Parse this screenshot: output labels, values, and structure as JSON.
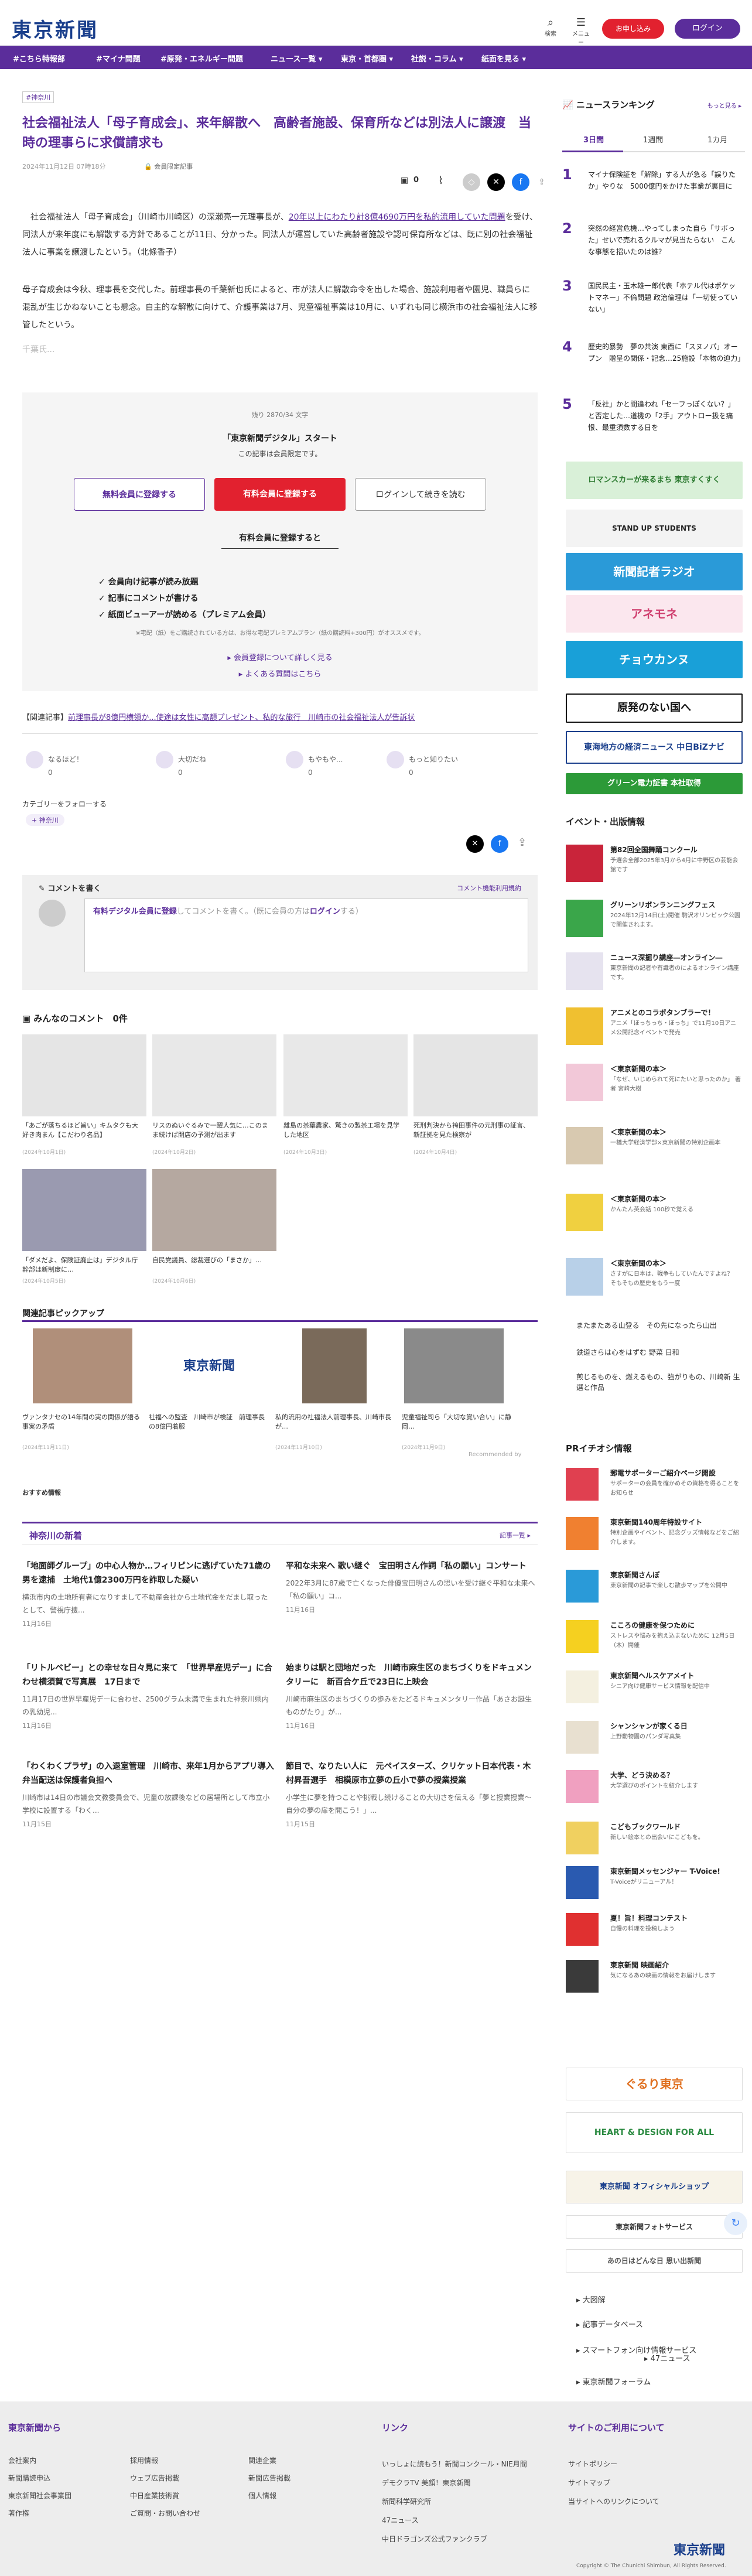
{
  "header": {
    "logo": "東京新聞",
    "search_label": "検索",
    "menu_label": "メニュー",
    "register_button": "お申し込み",
    "login_button": "ログイン"
  },
  "nav": [
    "#こちら特報部",
    "#マイナ問題",
    "#原発・エネルギー問題",
    "ニュース一覧 ▾",
    "東京・首都圏 ▾",
    "社説・コラム ▾",
    "紙面を見る ▾"
  ],
  "article": {
    "category_tag": "#神奈川",
    "title": "社会福祉法人「母子育成会」、来年解散へ　高齢者施設、保育所などは別法人に譲渡　当時の理事らに求償請求も",
    "date": "2024年11月12日 07時18分",
    "member_badge": "会員限定記事",
    "comment_count": "0",
    "para1a": "社会福祉法人「母子育成会」（川崎市川崎区）の深瀬亮一元理事長が、",
    "para1_link": "20年以上にわたり計8億4690万円を私的流用していた問題",
    "para1b": "を受け、同法人が来年度にも解散する方針であることが11日、分かった。同法人が運営していた高齢者施設や認可保育所などは、既に別の社会福祉法人に事業を譲渡したという。（北條香子）",
    "para2": "母子育成会は今秋、理事長を交代した。前理事長の千葉新也氏によると、市が法人に解散命令を出した場合、施設利用者や園児、職員らに混乱が生じかねないことも懸念。自主的な解散に向けて、介護事業は7月、児童福祉事業は10月に、いずれも同じ横浜市の社会福祉法人に移管したという。",
    "fade_text": "千葉氏..."
  },
  "paywall": {
    "remaining": "残り 2870/34 文字",
    "headline": "「東京新聞デジタル」スタート",
    "sub": "この記事は会員限定です。",
    "btn_free": "無料会員に登録する",
    "btn_paid": "有料会員に登録する",
    "btn_login": "ログインして続きを読む",
    "benefits_title": "有料会員に登録すると",
    "benefits": [
      "✓ 会員向け記事が読み放題",
      "✓ 記事にコメントが書ける",
      "✓ 紙面ビューアーが読める（プレミアム会員）"
    ],
    "note": "※宅配（紙）をご購読されている方は、お得な宅配プレミアムプラン（紙の購読料+300円）がオススメです。",
    "link_more": "▸ 会員登録について詳しく見る",
    "link_faq": "▸ よくある質問はこちら"
  },
  "related": {
    "prefix": "【関連記事】",
    "link": "前理事長が8億円横領か...使途は女性に高額プレゼント、私的な旅行　川崎市の社会福祉法人が告訴状"
  },
  "reactions": [
    "なるほど！",
    "大切だね",
    "もやもや...",
    "もっと知りたい"
  ],
  "reaction_counts": [
    "0",
    "0",
    "0",
    "0"
  ],
  "follow_label": "カテゴリーをフォローする",
  "follow_tag": "神奈川",
  "comment": {
    "title": "コメントを書く",
    "policy_link": "コメント機能利用規約",
    "input_text_link": "有料デジタル会員に登録",
    "input_text_mid": "してコメントを書く。（既に会員の方は",
    "input_text_login": "ログイン",
    "input_text_end": "する）"
  },
  "everyone_comments": {
    "title": "みんなのコメント",
    "count": "0件"
  },
  "recommend": [
    {
      "caption": "「あごが落ちるほど旨い」キムタクも大好き肉まん【こだわり名品】",
      "date": "(2024年10月1日)"
    },
    {
      "caption": "リスのぬいぐるみで一躍人気に…このまま続けば開店の予測が出ます",
      "date": "(2024年10月2日)"
    },
    {
      "caption": "離島の茶葉農家、驚きの製茶工場を見学した地区",
      "date": "(2024年10月3日)"
    },
    {
      "caption": "死刑判決から袴田事件の元刑事の証言、新証拠を見た検察が",
      "date": "(2024年10月4日)"
    },
    {
      "caption": "「ダメだよ、保険証廃止は」デジタル庁幹部は新制度に…",
      "date": "(2024年10月5日)"
    },
    {
      "caption": "自民党議員、総裁選びの「まさか」…",
      "date": "(2024年10月6日)"
    }
  ],
  "related_pickup": {
    "title": "関連記事ピックアップ",
    "items": [
      {
        "caption": "ヴァンタナセの14年間の実の関係が語る事実の矛盾",
        "date": "(2024年11月11日)"
      },
      {
        "caption": "社福への監査　川崎市が検証　前理事長の8億円着服",
        "date": ""
      },
      {
        "caption": "私的流用の社福法人前理事長、川崎市長が…",
        "date": "(2024年11月10日)"
      },
      {
        "caption": "児童福祉司ら「大切な覚い合い」に静岡…",
        "date": "(2024年11月9日)"
      }
    ],
    "credit": "Recommended by"
  },
  "osusume_title": "おすすめ情報",
  "kanagawa": {
    "title": "神奈川の新着",
    "more": "記事一覧 ▸",
    "articles": [
      {
        "title": "「地面師グループ」の中心人物か…フィリピンに逃げていた71歳の男を逮捕　土地代1億2300万円を詐取した疑い",
        "body": "横浜市内の土地所有者になりすまして不動産会社から土地代金をだまし取ったとして、警視庁捜...",
        "date": "11月16日"
      },
      {
        "title": "平和な未来へ 歌い継ぐ　宝田明さん作詞「私の願い」コンサート",
        "body": "2022年3月に87歳で亡くなった俳優宝田明さんの思いを受け継ぐ平和な未来へ「私の願い」コ...",
        "date": "11月16日"
      },
      {
        "title": "「リトルベビー」との幸せな日々見に来て　「世界早産児デー」に合わせ横須賀で写真展　17日まで",
        "body": "11月17日の世界早産児デーに合わせ、2500グラム未満で生まれた神奈川県内の乳幼児...",
        "date": "11月16日"
      },
      {
        "title": "始まりは駅と団地だった　川崎市麻生区のまちづくりをドキュメンタリーに　新百合ケ丘で23日に上映会",
        "body": "川崎市麻生区のまちづくりの歩みをたどるドキュメンタリー作品「あさお誕生ものがたり」が...",
        "date": "11月16日"
      },
      {
        "title": "「わくわくプラザ」の入退室管理　川崎市、来年1月からアプリ導入　弁当配送は保護者負担へ",
        "body": "川崎市は14日の市議会文教委員会で、児童の放課後などの居場所として市立小学校に設置する「わく...",
        "date": "11月15日"
      },
      {
        "title": "節目で、なりたい人に　元ペイスターズ、クリケット日本代表・木村昇吾選手　相模原市立夢の丘小で夢の授業授業",
        "body": "小学生に夢を持つことや挑戦し続けることの大切さを伝える「夢と授業授業〜自分の夢の扉を開こう！」...",
        "date": "11月15日"
      }
    ]
  },
  "sidebar": {
    "ranking_title": "ニュースランキング",
    "ranking_more": "もっと見る ▸",
    "tabs": [
      "3日間",
      "1週間",
      "1カ月"
    ],
    "ranking": [
      {
        "n": "1",
        "text": "マイナ保険証を「解除」する人が急る「誤りたか」やりな　5000億円をかけた事業が裏目に"
      },
      {
        "n": "2",
        "text": "突然の経営危機…やってしまった自ら「サボった」せいで売れるクルマが見当たらない　こんな事態を招いたのは誰？"
      },
      {
        "n": "3",
        "text": "国民民主・玉木雄一郎代表「ホテル代はポケットマネー」不倫問題 政治倫理は「一切使っていない」"
      },
      {
        "n": "4",
        "text": "歴史的暴勢　夢の共演 東西に「スヌノパ」オープン　贈呈の関係・記念…25施設「本物の迫力」"
      },
      {
        "n": "5",
        "text": "「反社」かと間違われ「セーフっぽくない？」と否定した…道機の「2手」アウトロー扱を痛恨、最重須数する日を"
      }
    ],
    "banners": [
      "ロマンスカーが来るまち 東京すくすく",
      "STAND UP STUDENTS",
      "新聞記者ラジオ",
      "アネモネ",
      "チョウカンヌ",
      "原発のない国へ",
      "東海地方の経済ニュース 中日BiZナビ",
      "グリーン電力証書 本社取得"
    ],
    "events_title": "イベント・出版情報",
    "events": [
      {
        "t": "第82回全国舞踊コンクール",
        "d": "予選会全部2025年3月から4月に中野区の芸能会館です"
      },
      {
        "t": "グリーンリボンランニングフェス",
        "d": "2024年12月14日(土)開催 駒沢オリンピック公園で開催されます。"
      },
      {
        "t": "ニュース深掘り講座―オンライン―",
        "d": "東京新聞の記者や有識者のによるオンライン講座です。"
      },
      {
        "t": "アニメとのコラボタンブラーで！",
        "d": "アニメ「ほっちっち・ほっち」で11月10日アニメ公開記念イベントで発売"
      },
      {
        "t": "＜東京新聞の本＞",
        "d": "「なぜ、いじめられて死にたいと思ったのか」 著者 宮崎大樹"
      },
      {
        "t": "＜東京新聞の本＞",
        "d": "一橋大学経済学部×東京新聞の特別企画本"
      },
      {
        "t": "＜東京新聞の本＞",
        "d": "かんたん英会話 100秒で覚える"
      },
      {
        "t": "＜東京新聞の本＞",
        "d": "さすがに日本は、戦争もしていたんですよね？　そもそもの歴史をもう一度"
      }
    ],
    "text_ads": [
      "またまたある山登る　その先になったら山出",
      "鉄道さらは心をはずむ  野菜 日和",
      "煎じるものを、燃えるもの、強がりもの、川崎新 生選と作品"
    ],
    "pr_title": "PRイチオシ情報",
    "pr": [
      {
        "t": "郵電サポーターご紹介ページ開設",
        "d": "サポーターの会員を確かめその資格を得ることをお知らせ"
      },
      {
        "t": "東京新聞140周年特設サイト",
        "d": "特別企画やイベント、記念グッズ情報などをご紹介します。"
      },
      {
        "t": "東京新聞さんぽ",
        "d": "東京新聞の記事で楽しむ散歩マップを公開中"
      },
      {
        "t": "こころの健康を保つために",
        "d": "ストレスや悩みを抱え込まないために 12月5日（木）開催"
      },
      {
        "t": "東京新聞ヘルスケアメイト",
        "d": "シニア向け健康サービス情報を配信中"
      },
      {
        "t": "シャンシャンが家くる日",
        "d": "上野動物園のパンダ写真集"
      },
      {
        "t": "大学、どう決める？",
        "d": "大学選びのポイントを紹介します"
      },
      {
        "t": "こどもブックワールド",
        "d": "新しい絵本との出会いにこどもを。"
      },
      {
        "t": "東京新聞メッセンジャー T-Voice!",
        "d": "T-Voiceがリニューアル！"
      },
      {
        "t": "夏！旨！料理コンテスト",
        "d": "自慢の料理を投稿しよう"
      },
      {
        "t": "東京新聞 映画紹介",
        "d": "気になるあの映画の情報をお届けします"
      }
    ],
    "bottom_banners": [
      "ぐるり東京",
      "HEART & DESIGN FOR ALL",
      "東京新聞 オフィシャルショップ",
      "東京新聞フォトサービス",
      "あの日はどんな日 思い出新聞"
    ],
    "bottom_links": [
      "▸ 大図解",
      "▸ 記事データベース",
      "▸ スマートフォン向け情報サービス",
      "▸ 47ニュース",
      "▸ 東京新聞フォーラム"
    ]
  },
  "footer": {
    "col1_title": "東京新聞から",
    "col1a": [
      "会社案内",
      "新聞購読申込",
      "東京新聞社会事業団",
      "著作権"
    ],
    "col1b": [
      "採用情報",
      "ウェブ広告掲載",
      "中日産業技術賞",
      "ご質問・お問い合わせ"
    ],
    "col1c": [
      "関連企業",
      "新聞広告掲載",
      "個人情報"
    ],
    "col2_title": "リンク",
    "col2": [
      "いっしょに読もう！新聞コンクール・NIE月間",
      "デモクラTV 美顔！東京新聞",
      "新聞科学研究所",
      "47ニュース",
      "中日ドラゴンズ公式ファンクラブ"
    ],
    "col3_title": "サイトのご利用について",
    "col3": [
      "サイトポリシー",
      "サイトマップ",
      "当サイトへのリンクについて"
    ],
    "logo": "東京新聞",
    "copyright": "Copyright © The Chunichi Shimbun, All Rights Reserved."
  },
  "colors": {
    "accent": "#5b2d9b",
    "red": "#e2212f",
    "navy": "#1a3f8c"
  }
}
